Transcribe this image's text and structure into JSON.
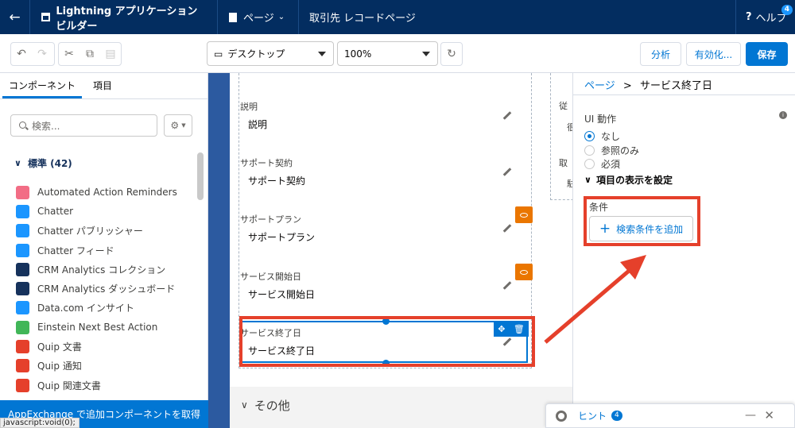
{
  "topbar": {
    "app_title": "Lightning アプリケーションビルダー",
    "page_menu": "ページ",
    "record_title": "取引先 レコードページ",
    "help": "ヘルプ",
    "help_badge": "4"
  },
  "toolbar": {
    "device": "デスクトップ",
    "zoom": "100%",
    "analyze": "分析",
    "activate": "有効化...",
    "save": "保存"
  },
  "left": {
    "tab_components": "コンポーネント",
    "tab_fields": "項目",
    "search_placeholder": "検索...",
    "section": "標準 (42)",
    "items": [
      {
        "label": "Automated Action Reminders",
        "color": "#f26d85"
      },
      {
        "label": "Chatter",
        "color": "#1b96ff"
      },
      {
        "label": "Chatter パブリッシャー",
        "color": "#1b96ff"
      },
      {
        "label": "Chatter フィード",
        "color": "#1b96ff"
      },
      {
        "label": "CRM Analytics コレクション",
        "color": "#16325c"
      },
      {
        "label": "CRM Analytics ダッシュボード",
        "color": "#16325c"
      },
      {
        "label": "Data.com インサイト",
        "color": "#1b96ff"
      },
      {
        "label": "Einstein Next Best Action",
        "color": "#41b658"
      },
      {
        "label": "Quip 文書",
        "color": "#e5402b"
      },
      {
        "label": "Quip 通知",
        "color": "#e5402b"
      },
      {
        "label": "Quip 関連文書",
        "color": "#e5402b"
      }
    ],
    "appexchange": "AppExchange で追加コンポーネントを取得",
    "status_bar": "javascript:void(0);"
  },
  "canvas": {
    "fields": [
      {
        "label": "説明",
        "value": "説明"
      },
      {
        "label": "サポート契約",
        "value": "サポート契約"
      },
      {
        "label": "サポートプラン",
        "value": "サポートプラン"
      },
      {
        "label": "サービス開始日",
        "value": "サービス開始日"
      },
      {
        "label": "サービス終了日",
        "value": "サービス終了日"
      }
    ],
    "col2_labels": [
      "従",
      "很",
      "取",
      "駐"
    ],
    "other_section": "その他"
  },
  "right": {
    "crumb_parent": "ページ",
    "crumb_sep": ">",
    "crumb_current": "サービス終了日",
    "ui_behavior": "UI 動作",
    "options": [
      "なし",
      "参照のみ",
      "必須"
    ],
    "visibility": "項目の表示を設定",
    "condition": "条件",
    "add_filter": "検索条件を追加"
  },
  "hint": {
    "label": "ヒント",
    "count": "4"
  }
}
